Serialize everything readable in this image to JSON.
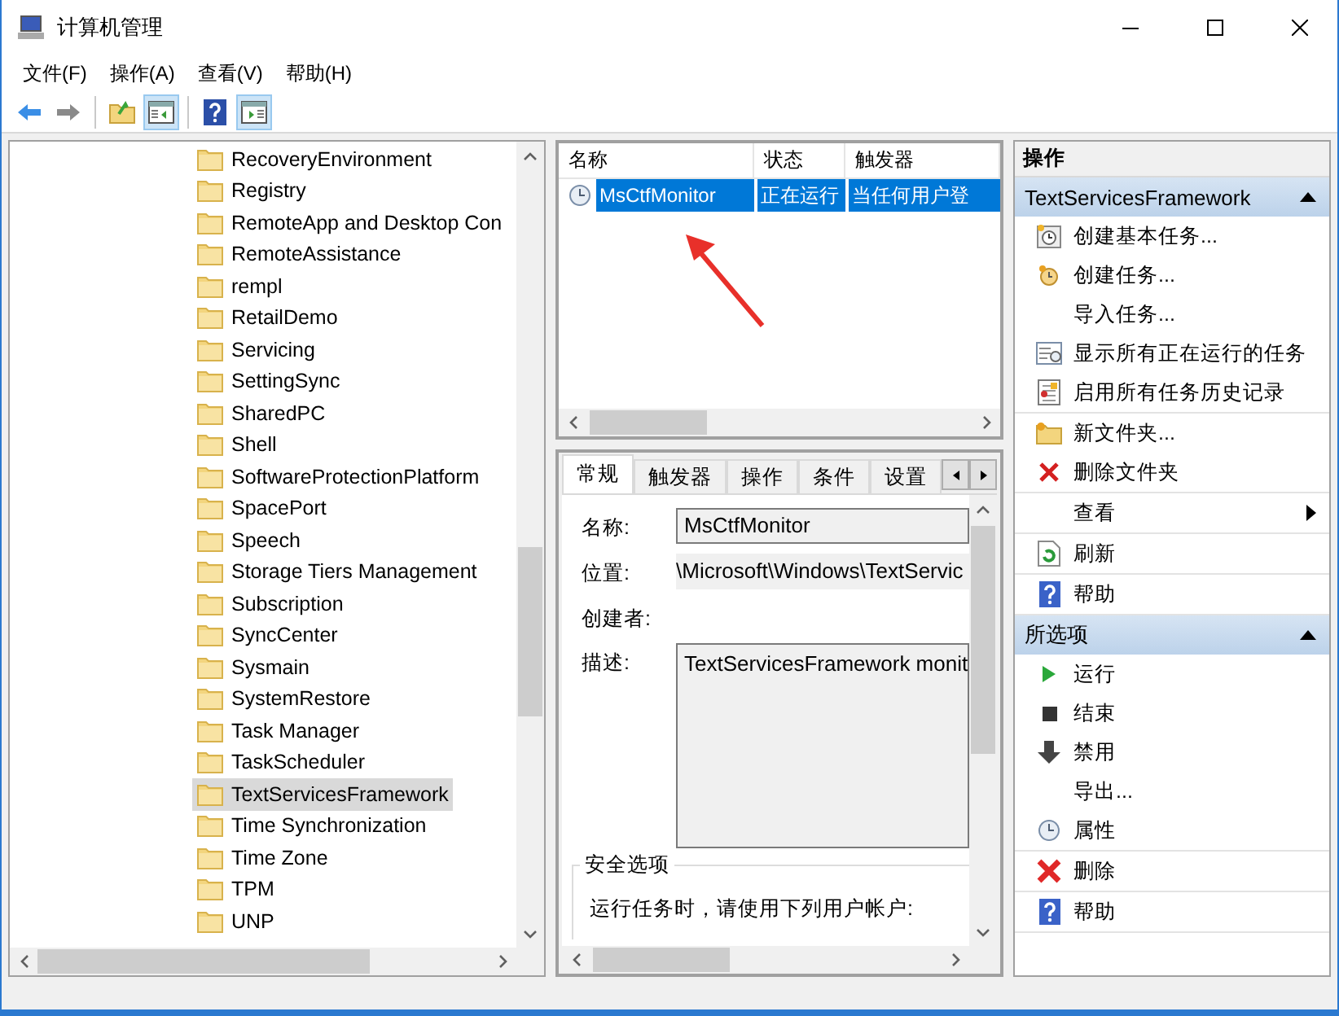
{
  "window": {
    "title": "计算机管理"
  },
  "menu": [
    "文件(F)",
    "操作(A)",
    "查看(V)",
    "帮助(H)"
  ],
  "toolbar": [
    {
      "kind": "back",
      "pressed": false
    },
    {
      "kind": "forward",
      "pressed": false
    },
    {
      "kind": "separator"
    },
    {
      "kind": "folder-up",
      "pressed": false
    },
    {
      "kind": "pane-left",
      "pressed": true
    },
    {
      "kind": "separator"
    },
    {
      "kind": "help",
      "pressed": false
    },
    {
      "kind": "pane-right",
      "pressed": true
    }
  ],
  "tree": {
    "items": [
      {
        "label": "RecoveryEnvironment",
        "selected": false
      },
      {
        "label": "Registry",
        "selected": false
      },
      {
        "label": "RemoteApp and Desktop Con",
        "selected": false
      },
      {
        "label": "RemoteAssistance",
        "selected": false
      },
      {
        "label": "rempl",
        "selected": false
      },
      {
        "label": "RetailDemo",
        "selected": false
      },
      {
        "label": "Servicing",
        "selected": false
      },
      {
        "label": "SettingSync",
        "selected": false
      },
      {
        "label": "SharedPC",
        "selected": false
      },
      {
        "label": "Shell",
        "selected": false
      },
      {
        "label": "SoftwareProtectionPlatform",
        "selected": false
      },
      {
        "label": "SpacePort",
        "selected": false
      },
      {
        "label": "Speech",
        "selected": false
      },
      {
        "label": "Storage Tiers Management",
        "selected": false
      },
      {
        "label": "Subscription",
        "selected": false
      },
      {
        "label": "SyncCenter",
        "selected": false
      },
      {
        "label": "Sysmain",
        "selected": false
      },
      {
        "label": "SystemRestore",
        "selected": false
      },
      {
        "label": "Task Manager",
        "selected": false
      },
      {
        "label": "TaskScheduler",
        "selected": false
      },
      {
        "label": "TextServicesFramework",
        "selected": true
      },
      {
        "label": "Time Synchronization",
        "selected": false
      },
      {
        "label": "Time Zone",
        "selected": false
      },
      {
        "label": "TPM",
        "selected": false
      },
      {
        "label": "UNP",
        "selected": false
      }
    ]
  },
  "task_list": {
    "columns": [
      "名称",
      "状态",
      "触发器"
    ],
    "rows": [
      {
        "cells": [
          "MsCtfMonitor",
          "正在运行",
          "当任何用户登"
        ],
        "selected": true
      }
    ]
  },
  "details": {
    "tabs": [
      {
        "label": "常规",
        "selected": true
      },
      {
        "label": "触发器",
        "selected": false
      },
      {
        "label": "操作",
        "selected": false
      },
      {
        "label": "条件",
        "selected": false
      },
      {
        "label": "设置",
        "selected": false
      }
    ],
    "fields": [
      {
        "kind": "input",
        "label": "名称:",
        "value": "MsCtfMonitor"
      },
      {
        "kind": "text",
        "label": "位置:",
        "value": "\\Microsoft\\Windows\\TextServic"
      },
      {
        "kind": "text",
        "label": "创建者:"
      },
      {
        "kind": "textarea",
        "label": "描述:",
        "value": "TextServicesFramework monit"
      }
    ],
    "security": {
      "title": "安全选项",
      "text": "运行任务时，请使用下列用户帐户:"
    }
  },
  "actions": {
    "title": "操作",
    "sections": [
      {
        "title": "TextServicesFramework",
        "expanded": true,
        "groups": [
          [
            {
              "kind": "basic-task",
              "label": "创建基本任务..."
            },
            {
              "kind": "task",
              "label": "创建任务..."
            },
            {
              "kind": "none",
              "label": "导入任务..."
            },
            {
              "kind": "running",
              "label": "显示所有正在运行的任务"
            },
            {
              "kind": "history",
              "label": "启用所有任务历史记录"
            }
          ],
          [
            {
              "kind": "folder",
              "label": "新文件夹..."
            },
            {
              "kind": "delete",
              "label": "删除文件夹"
            }
          ],
          [
            {
              "kind": "submenu",
              "label": "查看"
            }
          ],
          [
            {
              "kind": "refresh",
              "label": "刷新"
            }
          ],
          [
            {
              "kind": "help",
              "label": "帮助"
            }
          ]
        ]
      },
      {
        "title": "所选项",
        "expanded": true,
        "groups": [
          [
            {
              "kind": "run",
              "label": "运行"
            },
            {
              "kind": "stop",
              "label": "结束"
            },
            {
              "kind": "disable",
              "label": "禁用"
            },
            {
              "kind": "none",
              "label": "导出..."
            },
            {
              "kind": "properties",
              "label": "属性"
            }
          ],
          [
            {
              "kind": "delete-large",
              "label": "删除"
            }
          ],
          [
            {
              "kind": "help",
              "label": "帮助"
            }
          ]
        ]
      }
    ]
  }
}
